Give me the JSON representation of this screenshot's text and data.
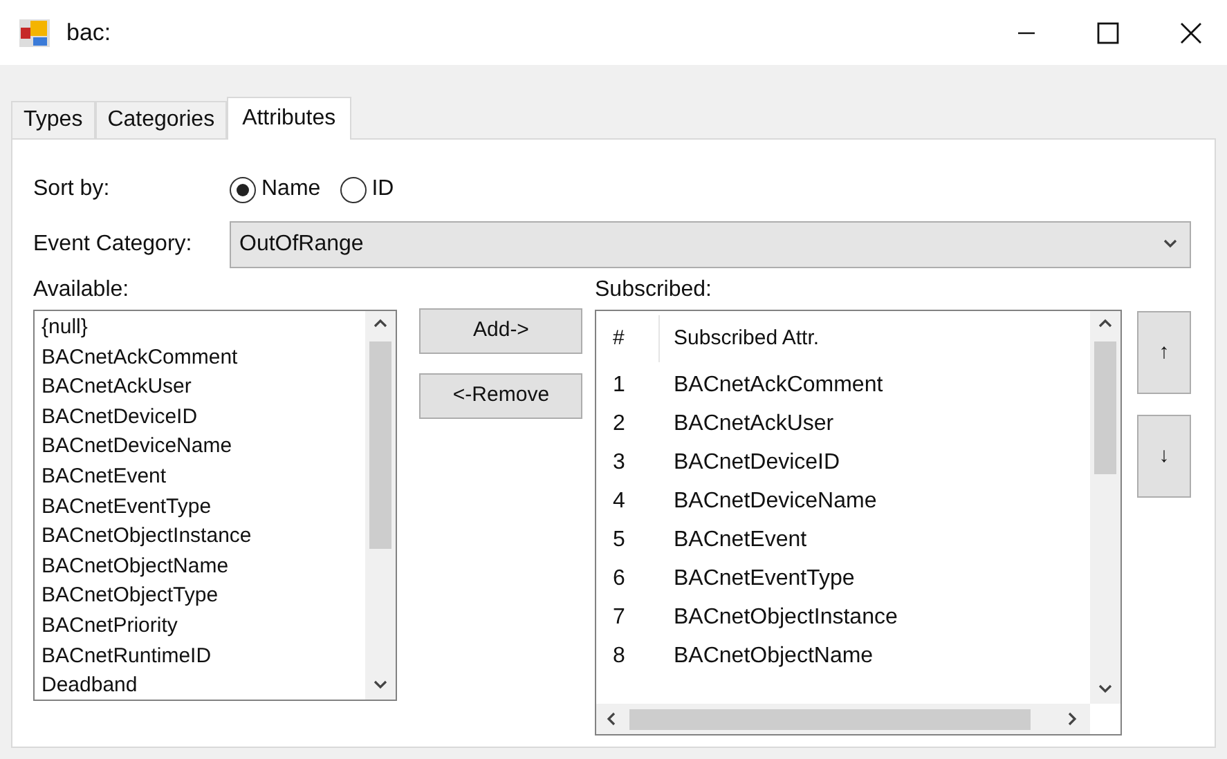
{
  "window": {
    "title": "bac:"
  },
  "tabs": [
    {
      "label": "Types",
      "selected": false
    },
    {
      "label": "Categories",
      "selected": false
    },
    {
      "label": "Attributes",
      "selected": true
    }
  ],
  "sort_by": {
    "label": "Sort by:",
    "options": [
      {
        "label": "Name",
        "selected": true
      },
      {
        "label": "ID",
        "selected": false
      }
    ]
  },
  "event_category": {
    "label": "Event Category:",
    "value": "OutOfRange"
  },
  "available": {
    "label": "Available:",
    "items": [
      "{null}",
      "BACnetAckComment",
      "BACnetAckUser",
      "BACnetDeviceID",
      "BACnetDeviceName",
      "BACnetEvent",
      "BACnetEventType",
      "BACnetObjectInstance",
      "BACnetObjectName",
      "BACnetObjectType",
      "BACnetPriority",
      "BACnetRuntimeID",
      "Deadband"
    ]
  },
  "buttons": {
    "add": "Add->",
    "remove": "<-Remove",
    "up": "↑",
    "down": "↓"
  },
  "subscribed": {
    "label": "Subscribed:",
    "columns": [
      "#",
      "Subscribed Attr."
    ],
    "rows": [
      {
        "num": "1",
        "attr": "BACnetAckComment"
      },
      {
        "num": "2",
        "attr": "BACnetAckUser"
      },
      {
        "num": "3",
        "attr": "BACnetDeviceID"
      },
      {
        "num": "4",
        "attr": "BACnetDeviceName"
      },
      {
        "num": "5",
        "attr": "BACnetEvent"
      },
      {
        "num": "6",
        "attr": "BACnetEventType"
      },
      {
        "num": "7",
        "attr": "BACnetObjectInstance"
      },
      {
        "num": "8",
        "attr": "BACnetObjectName"
      }
    ]
  }
}
